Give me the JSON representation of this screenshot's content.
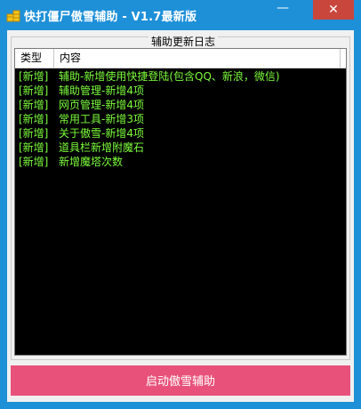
{
  "window": {
    "title": "快打僵尸傲雪辅助 - V1.7最新版",
    "minimize_glyph": "—",
    "close_glyph": "✕"
  },
  "group": {
    "title": "辅助更新日志"
  },
  "list": {
    "columns": [
      "类型",
      "内容"
    ],
    "rows": [
      {
        "type": "[新增]",
        "content": "辅助-新增使用快捷登陆(包含QQ、新浪，微信)"
      },
      {
        "type": "[新增]",
        "content": "辅助管理-新增4项"
      },
      {
        "type": "[新增]",
        "content": "网页管理-新增4项"
      },
      {
        "type": "[新增]",
        "content": "常用工具-新增3项"
      },
      {
        "type": "[新增]",
        "content": "关于傲雪-新增4项"
      },
      {
        "type": "[新增]",
        "content": "道具栏新增附魔石"
      },
      {
        "type": "[新增]",
        "content": "新增魔塔次数"
      }
    ]
  },
  "start_button": {
    "label": "启动傲雪辅助"
  },
  "colors": {
    "titlebar": "#1e90d8",
    "close": "#c9463d",
    "list_bg": "#000000",
    "row_text": "#7cfc3c",
    "start_button": "#e8527a"
  },
  "icons": {
    "app": "gold-coins-icon"
  }
}
